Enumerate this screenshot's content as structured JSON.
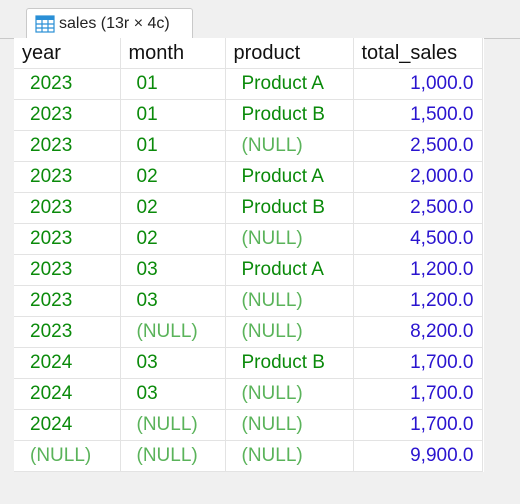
{
  "tab": {
    "label": "sales (13r × 4c)",
    "icon": "table-grid-icon"
  },
  "grid": {
    "columns": [
      "year",
      "month",
      "product",
      "total_sales"
    ],
    "rows": [
      [
        "2023",
        "01",
        "Product A",
        "1,000.0"
      ],
      [
        "2023",
        "01",
        "Product B",
        "1,500.0"
      ],
      [
        "2023",
        "01",
        "(NULL)",
        "2,500.0"
      ],
      [
        "2023",
        "02",
        "Product A",
        "2,000.0"
      ],
      [
        "2023",
        "02",
        "Product B",
        "2,500.0"
      ],
      [
        "2023",
        "02",
        "(NULL)",
        "4,500.0"
      ],
      [
        "2023",
        "03",
        "Product A",
        "1,200.0"
      ],
      [
        "2023",
        "03",
        "(NULL)",
        "1,200.0"
      ],
      [
        "2023",
        "(NULL)",
        "(NULL)",
        "8,200.0"
      ],
      [
        "2024",
        "03",
        "Product B",
        "1,700.0"
      ],
      [
        "2024",
        "03",
        "(NULL)",
        "1,700.0"
      ],
      [
        "2024",
        "(NULL)",
        "(NULL)",
        "1,700.0"
      ],
      [
        "(NULL)",
        "(NULL)",
        "(NULL)",
        "9,900.0"
      ]
    ]
  },
  "colors": {
    "text_value": "#0a8a0a",
    "null_value": "#5ab35a",
    "number_value": "#2a14cf"
  }
}
